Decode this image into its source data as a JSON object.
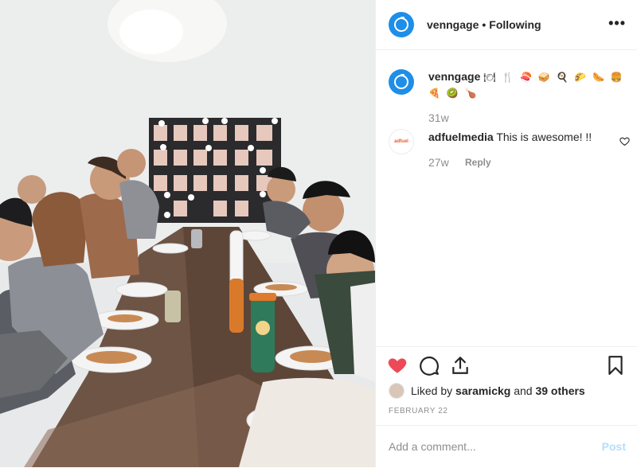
{
  "header": {
    "username": "venngage",
    "separator": "•",
    "follow_status": "Following",
    "more_label": "•••"
  },
  "caption": {
    "username": "venngage",
    "emojis": "🍽 🍴 🍣 🥪 🍳 🌮 🌭 🍔 🍕 🥝 🍗",
    "timestamp": "31w"
  },
  "comments": [
    {
      "avatar_text": "adfuel",
      "username": "adfuelmedia",
      "text": "This is awesome! !!",
      "timestamp": "27w",
      "reply_label": "Reply"
    }
  ],
  "likes": {
    "prefix": "Liked by",
    "user": "saramickg",
    "joiner": "and",
    "others": "39 others"
  },
  "date": "FEBRUARY 22",
  "add_comment": {
    "placeholder": "Add a comment...",
    "post_label": "Post"
  },
  "colors": {
    "brand_blue": "#1e8ee8",
    "like_red": "#ed4956",
    "post_disabled": "#b2dffc",
    "muted": "#8e8e8e"
  },
  "icons": [
    "heart-icon",
    "comment-icon",
    "share-icon",
    "bookmark-icon",
    "more-icon",
    "heart-outline-icon"
  ]
}
